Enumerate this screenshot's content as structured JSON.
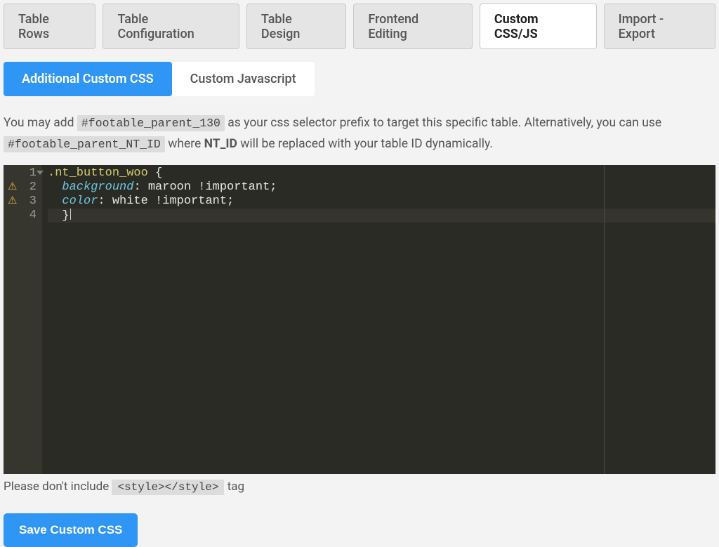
{
  "top_tabs": {
    "table_rows": "Table Rows",
    "table_configuration": "Table Configuration",
    "table_design": "Table Design",
    "frontend_editing": "Frontend Editing",
    "custom_css_js": "Custom CSS/JS",
    "import_export": "Import - Export",
    "active": "custom_css_js"
  },
  "sub_tabs": {
    "additional_css": "Additional Custom CSS",
    "custom_js": "Custom Javascript",
    "active": "additional_css"
  },
  "helper": {
    "part1": "You may add ",
    "code1": "#footable_parent_130",
    "part2": " as your css selector prefix to target this specific table. Alternatively, you can use ",
    "code2": "#footable_parent_NT_ID",
    "part3": " where ",
    "bold": "NT_ID",
    "part4": " will be replaced with your table ID dynamically."
  },
  "editor": {
    "gutter": [
      "1",
      "2",
      "3",
      "4"
    ],
    "warnings": [
      false,
      true,
      true,
      false
    ],
    "line1": {
      "sel": ".nt_button_woo",
      "brace": " {"
    },
    "line2": {
      "indent": "  ",
      "prop": "background",
      "colon": ": ",
      "val": "maroon !important;"
    },
    "line3": {
      "indent": "  ",
      "prop": "color",
      "colon": ": ",
      "val": "white !important;"
    },
    "line4": {
      "indent": "  ",
      "brace": "}"
    }
  },
  "bottom_hint": {
    "part1": "Please don't include ",
    "code": "<style></style>",
    "part2": " tag"
  },
  "save_button": "Save Custom CSS"
}
